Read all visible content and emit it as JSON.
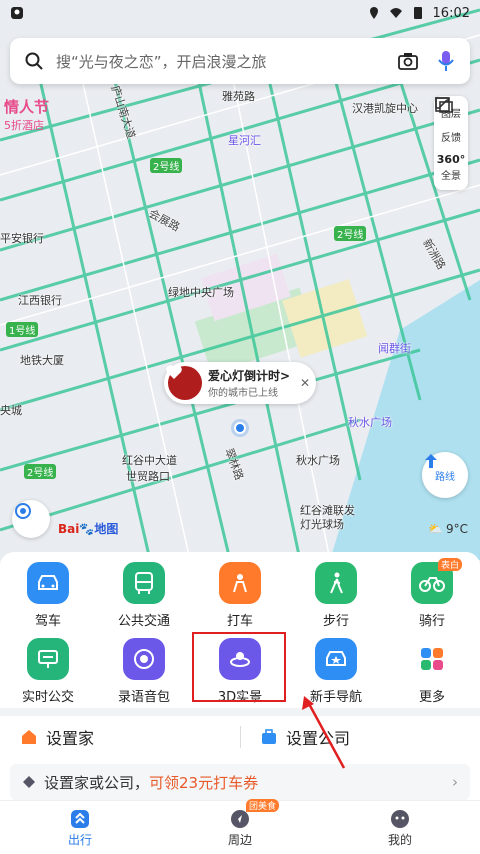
{
  "status": {
    "time": "16:02"
  },
  "search": {
    "placeholder": "搜“光与夜之恋”，开启浪漫之旅"
  },
  "tools": {
    "layers": "图层",
    "feedback": "反馈",
    "panorama_num": "360°",
    "panorama": "全景"
  },
  "route": {
    "label": "路线"
  },
  "weather": {
    "temp": "9°C"
  },
  "promo": {
    "line1": "情人节",
    "line2": "5折酒店"
  },
  "bubble": {
    "title": "爱心灯倒计时>",
    "subtitle": "你的城市已上线"
  },
  "map": {
    "pois": [
      "雅苑路",
      "汉港凯旋中心",
      "星河汇",
      "平安银行",
      "江西银行",
      "绿地中央广场",
      "地铁大厦",
      "闻群街",
      "央城",
      "秋水广场",
      "红谷中大道",
      "世贸路口",
      "秋水广场",
      "红谷滩联发",
      "灯光球场"
    ],
    "roads": [
      "会展路",
      "翠林路",
      "新洲路",
      "庐山南大道",
      "会展路"
    ],
    "lines": [
      "2号线",
      "2号线",
      "1号线",
      "2号线"
    ],
    "logo": "Bai",
    "logo_b": "地图"
  },
  "grid": [
    {
      "label": "驾车",
      "color": "#2f8ef4"
    },
    {
      "label": "公共交通",
      "color": "#25b57a"
    },
    {
      "label": "打车",
      "color": "#ff7a2a"
    },
    {
      "label": "步行",
      "color": "#29b970"
    },
    {
      "label": "骑行",
      "color": "#29b970",
      "tag": "表白"
    },
    {
      "label": "实时公交",
      "color": "#25b57a"
    },
    {
      "label": "录语音包",
      "color": "#6b57e8"
    },
    {
      "label": "3D实景",
      "color": "#6b57e8"
    },
    {
      "label": "新手导航",
      "color": "#2f8ef4"
    },
    {
      "label": "更多",
      "color": "#ffffff"
    }
  ],
  "home": {
    "set_home": "设置家",
    "set_company": "设置公司"
  },
  "coupon": {
    "prefix": "设置家或公司，",
    "highlight": "可领23元打车券",
    "arrow": "›"
  },
  "tabs": [
    {
      "label": "出行",
      "active": true
    },
    {
      "label": "周边",
      "badge": "团美食"
    },
    {
      "label": "我的"
    }
  ]
}
